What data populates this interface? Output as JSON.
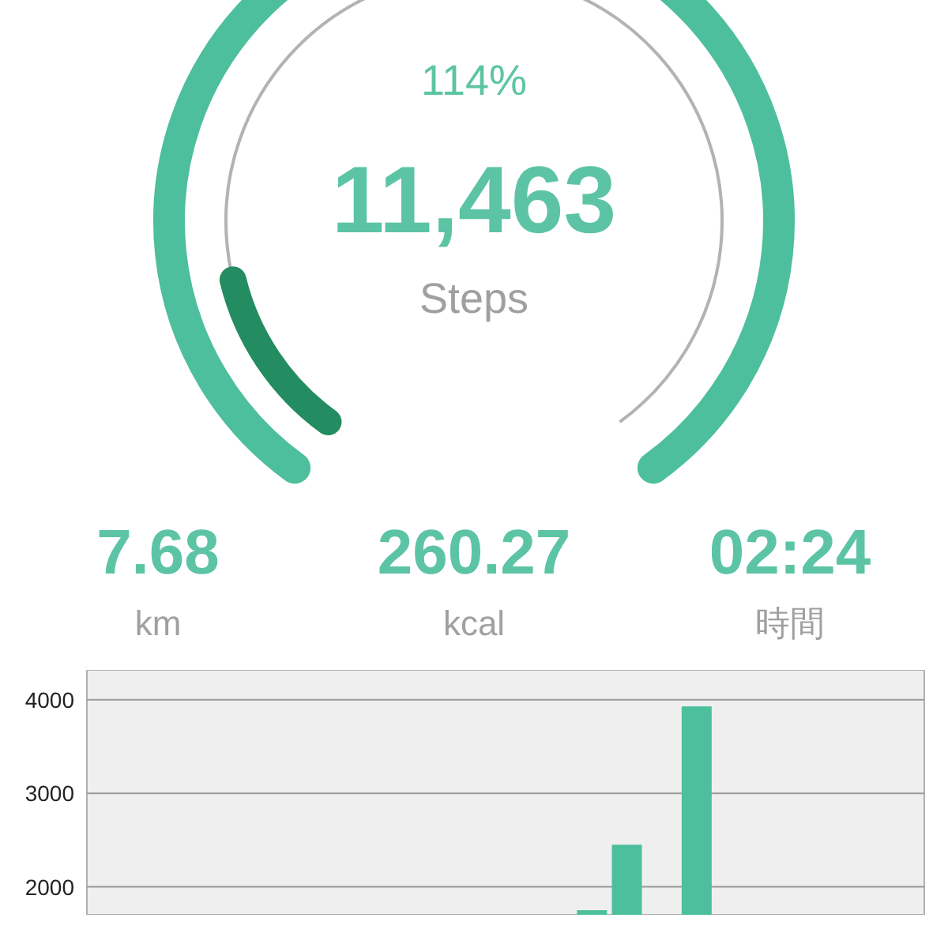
{
  "gauge": {
    "overflow": {
      "level": 0.14
    },
    "percent": "114%",
    "steps": "11,463",
    "unit": "Steps"
  },
  "stats": [
    {
      "value": "7.68",
      "label": "km"
    },
    {
      "value": "260.27",
      "label": "kcal"
    },
    {
      "value": "02:24",
      "label": "時間"
    }
  ],
  "chart": {
    "chart_data": {
      "type": "bar",
      "grid": true,
      "ylim": [
        1700,
        4320
      ],
      "yticks": [
        2000,
        3000,
        4000
      ],
      "series": [
        {
          "color": "#4dbf9c",
          "values": [
            null,
            null,
            null,
            null,
            null,
            null,
            null,
            null,
            null,
            null,
            null,
            null,
            null,
            null,
            1750,
            2450,
            null,
            3930,
            null,
            null,
            null,
            null,
            null,
            null
          ]
        }
      ]
    }
  }
}
